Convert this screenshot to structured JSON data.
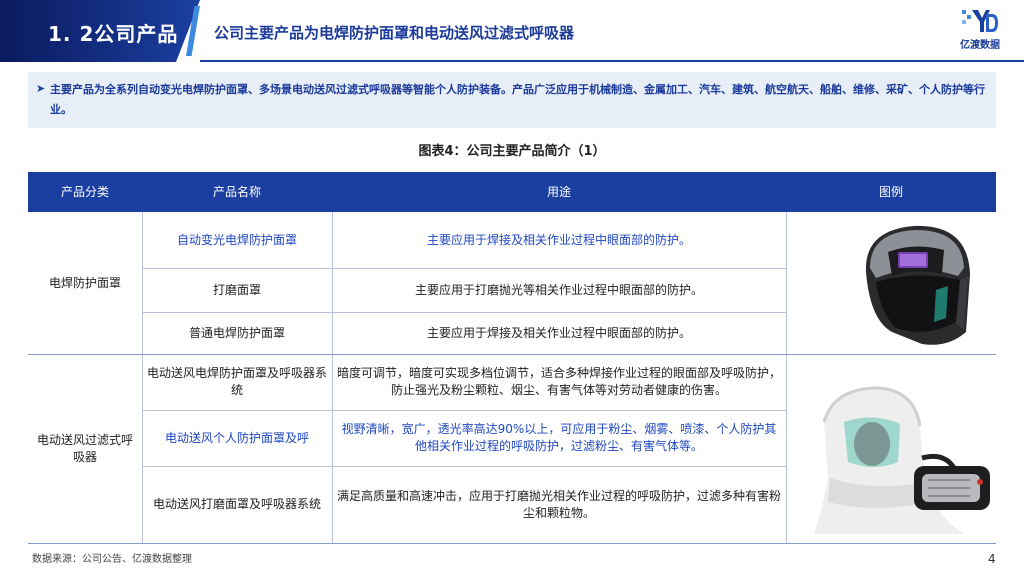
{
  "header": {
    "section": "1. 2公司产品",
    "title": "公司主要产品为电焊防护面罩和电动送风过滤式呼吸器",
    "logo_text": "亿渡数据",
    "brand_color": "#1b3fa0"
  },
  "intro": {
    "arrow_icon": "triangle-right-icon",
    "text": "主要产品为全系列自动变光电焊防护面罩、多场景电动送风过滤式呼吸器等智能个人防护装备。产品广泛应用于机械制造、金属加工、汽车、建筑、航空航天、船舶、维修、采矿、个人防护等行业。"
  },
  "figure_title": "图表4：公司主要产品简介（1）",
  "table": {
    "headers": [
      "产品分类",
      "产品名称",
      "用途",
      "图例"
    ],
    "groups": [
      {
        "category": "电焊防护面罩",
        "rows": [
          {
            "name": "自动变光电焊防护面罩",
            "usage": "主要应用于焊接及相关作业过程中眼面部的防护。"
          },
          {
            "name": "打磨面罩",
            "usage": "主要应用于打磨抛光等相关作业过程中眼面部的防护。"
          },
          {
            "name": "普通电焊防护面罩",
            "usage": "主要应用于焊接及相关作业过程中眼面部的防护。"
          }
        ]
      },
      {
        "category": "电动送风过滤式呼吸器",
        "rows": [
          {
            "name": "电动送风电焊防护面罩及呼吸器系统",
            "usage": "暗度可调节，暗度可实现多档位调节，适合多种焊接作业过程的眼面部及呼吸防护，防止强光及粉尘颗粒、烟尘、有害气体等对劳动者健康的伤害。"
          },
          {
            "name": "电动送风个人防护面罩及呼",
            "usage": "视野清晰，宽广，透光率高达90%以上，可应用于粉尘、烟雾、喷漆、个人防护其他相关作业过程的呼吸防护，过滤粉尘、有害气体等。"
          },
          {
            "name": "电动送风打磨面罩及呼吸器系统",
            "usage": "满足高质量和高速冲击，应用于打磨抛光相关作业过程的呼吸防护，过滤多种有害粉尘和颗粒物。"
          }
        ]
      }
    ]
  },
  "footer": {
    "source": "数据来源：公司公告、亿渡数据整理",
    "page": "4"
  }
}
